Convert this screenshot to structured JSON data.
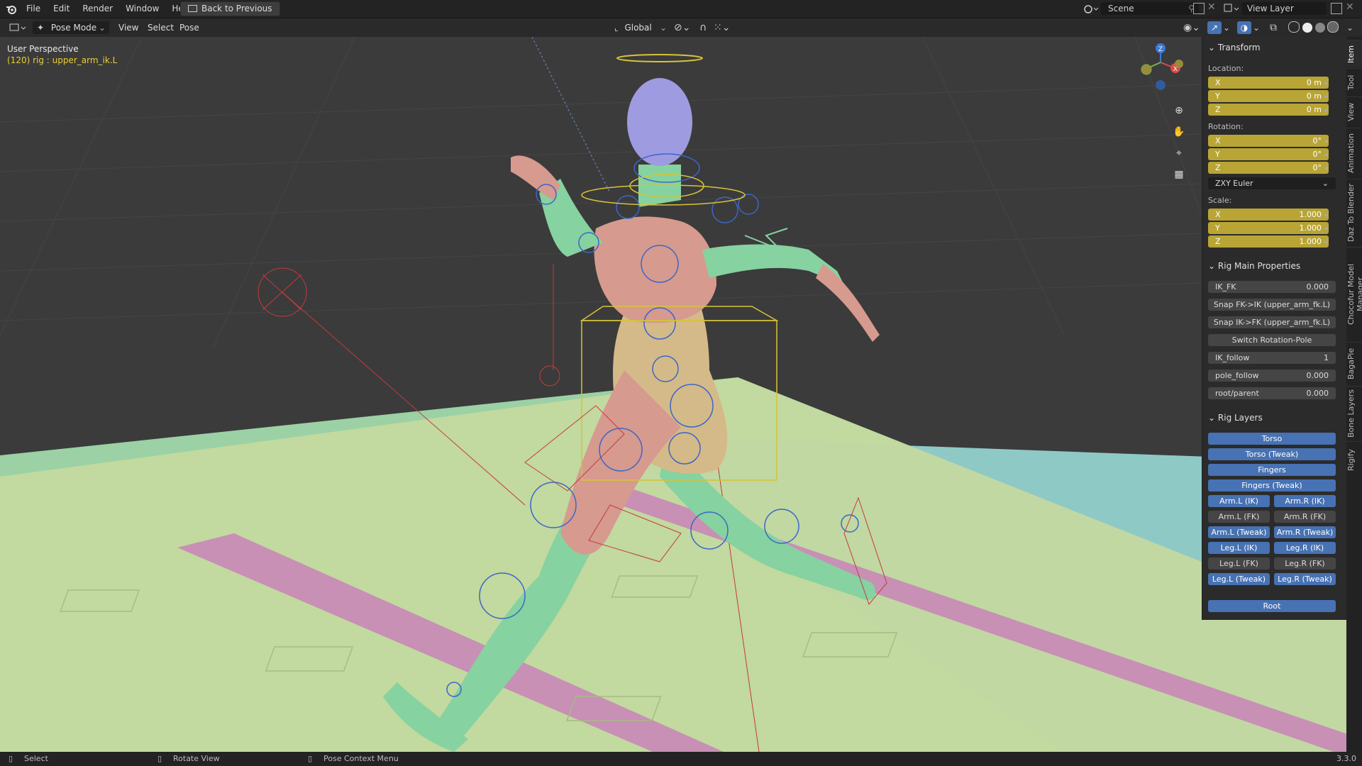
{
  "topbar": {
    "menus": [
      "File",
      "Edit",
      "Render",
      "Window",
      "Help"
    ],
    "back_button": "Back to Previous",
    "scene": "Scene",
    "view_layer": "View Layer"
  },
  "header": {
    "mode": "Pose Mode",
    "menus": [
      "View",
      "Select",
      "Pose"
    ],
    "transform_orientation": "Global"
  },
  "viewport": {
    "perspective": "User Perspective",
    "active": "(120) rig : upper_arm_ik.L",
    "gizmo_axis": [
      "Z",
      "X"
    ]
  },
  "transform": {
    "title": "Transform",
    "location_label": "Location:",
    "location": [
      {
        "axis": "X",
        "value": "0 m"
      },
      {
        "axis": "Y",
        "value": "0 m"
      },
      {
        "axis": "Z",
        "value": "0 m"
      }
    ],
    "rotation_label": "Rotation:",
    "rotation": [
      {
        "axis": "X",
        "value": "0°"
      },
      {
        "axis": "Y",
        "value": "0°"
      },
      {
        "axis": "Z",
        "value": "0°"
      }
    ],
    "rotation_mode": "ZXY Euler",
    "scale_label": "Scale:",
    "scale": [
      {
        "axis": "X",
        "value": "1.000"
      },
      {
        "axis": "Y",
        "value": "1.000"
      },
      {
        "axis": "Z",
        "value": "1.000"
      }
    ]
  },
  "rig_main": {
    "title": "Rig Main Properties",
    "ik_fk": {
      "label": "IK_FK",
      "value": "0.000"
    },
    "snap1": "Snap FK->IK (upper_arm_fk.L)",
    "snap2": "Snap IK->FK (upper_arm_fk.L)",
    "switch_pole": "Switch Rotation-Pole",
    "ik_follow": {
      "label": "IK_follow",
      "value": "1"
    },
    "pole_follow": {
      "label": "pole_follow",
      "value": "0.000"
    },
    "root_parent": {
      "label": "root/parent",
      "value": "0.000"
    }
  },
  "rig_layers": {
    "title": "Rig Layers",
    "torso": "Torso",
    "torso_tweak": "Torso (Tweak)",
    "fingers": "Fingers",
    "fingers_tweak": "Fingers (Tweak)",
    "arm_l_ik": "Arm.L (IK)",
    "arm_r_ik": "Arm.R (IK)",
    "arm_l_fk": "Arm.L (FK)",
    "arm_r_fk": "Arm.R (FK)",
    "arm_l_tweak": "Arm.L (Tweak)",
    "arm_r_tweak": "Arm.R (Tweak)",
    "leg_l_ik": "Leg.L (IK)",
    "leg_r_ik": "Leg.R (IK)",
    "leg_l_fk": "Leg.L (FK)",
    "leg_r_fk": "Leg.R (FK)",
    "leg_l_tweak": "Leg.L (Tweak)",
    "leg_r_tweak": "Leg.R (Tweak)",
    "root": "Root"
  },
  "tabs": [
    "Item",
    "Tool",
    "View",
    "Animation",
    "Daz To Blender",
    "Chocofur Model Manager",
    "BagaPie",
    "Bone Layers",
    "Rigify"
  ],
  "statusbar": {
    "select": "Select",
    "rotate": "Rotate View",
    "context": "Pose Context Menu",
    "version": "3.3.0"
  },
  "colors": {
    "accent_blue": "#4772b3",
    "field_yellow": "#b9a535",
    "floor_green": "#9bd1a5",
    "floor_pink": "#c890b5",
    "floor_teal": "#8fc9c6"
  }
}
